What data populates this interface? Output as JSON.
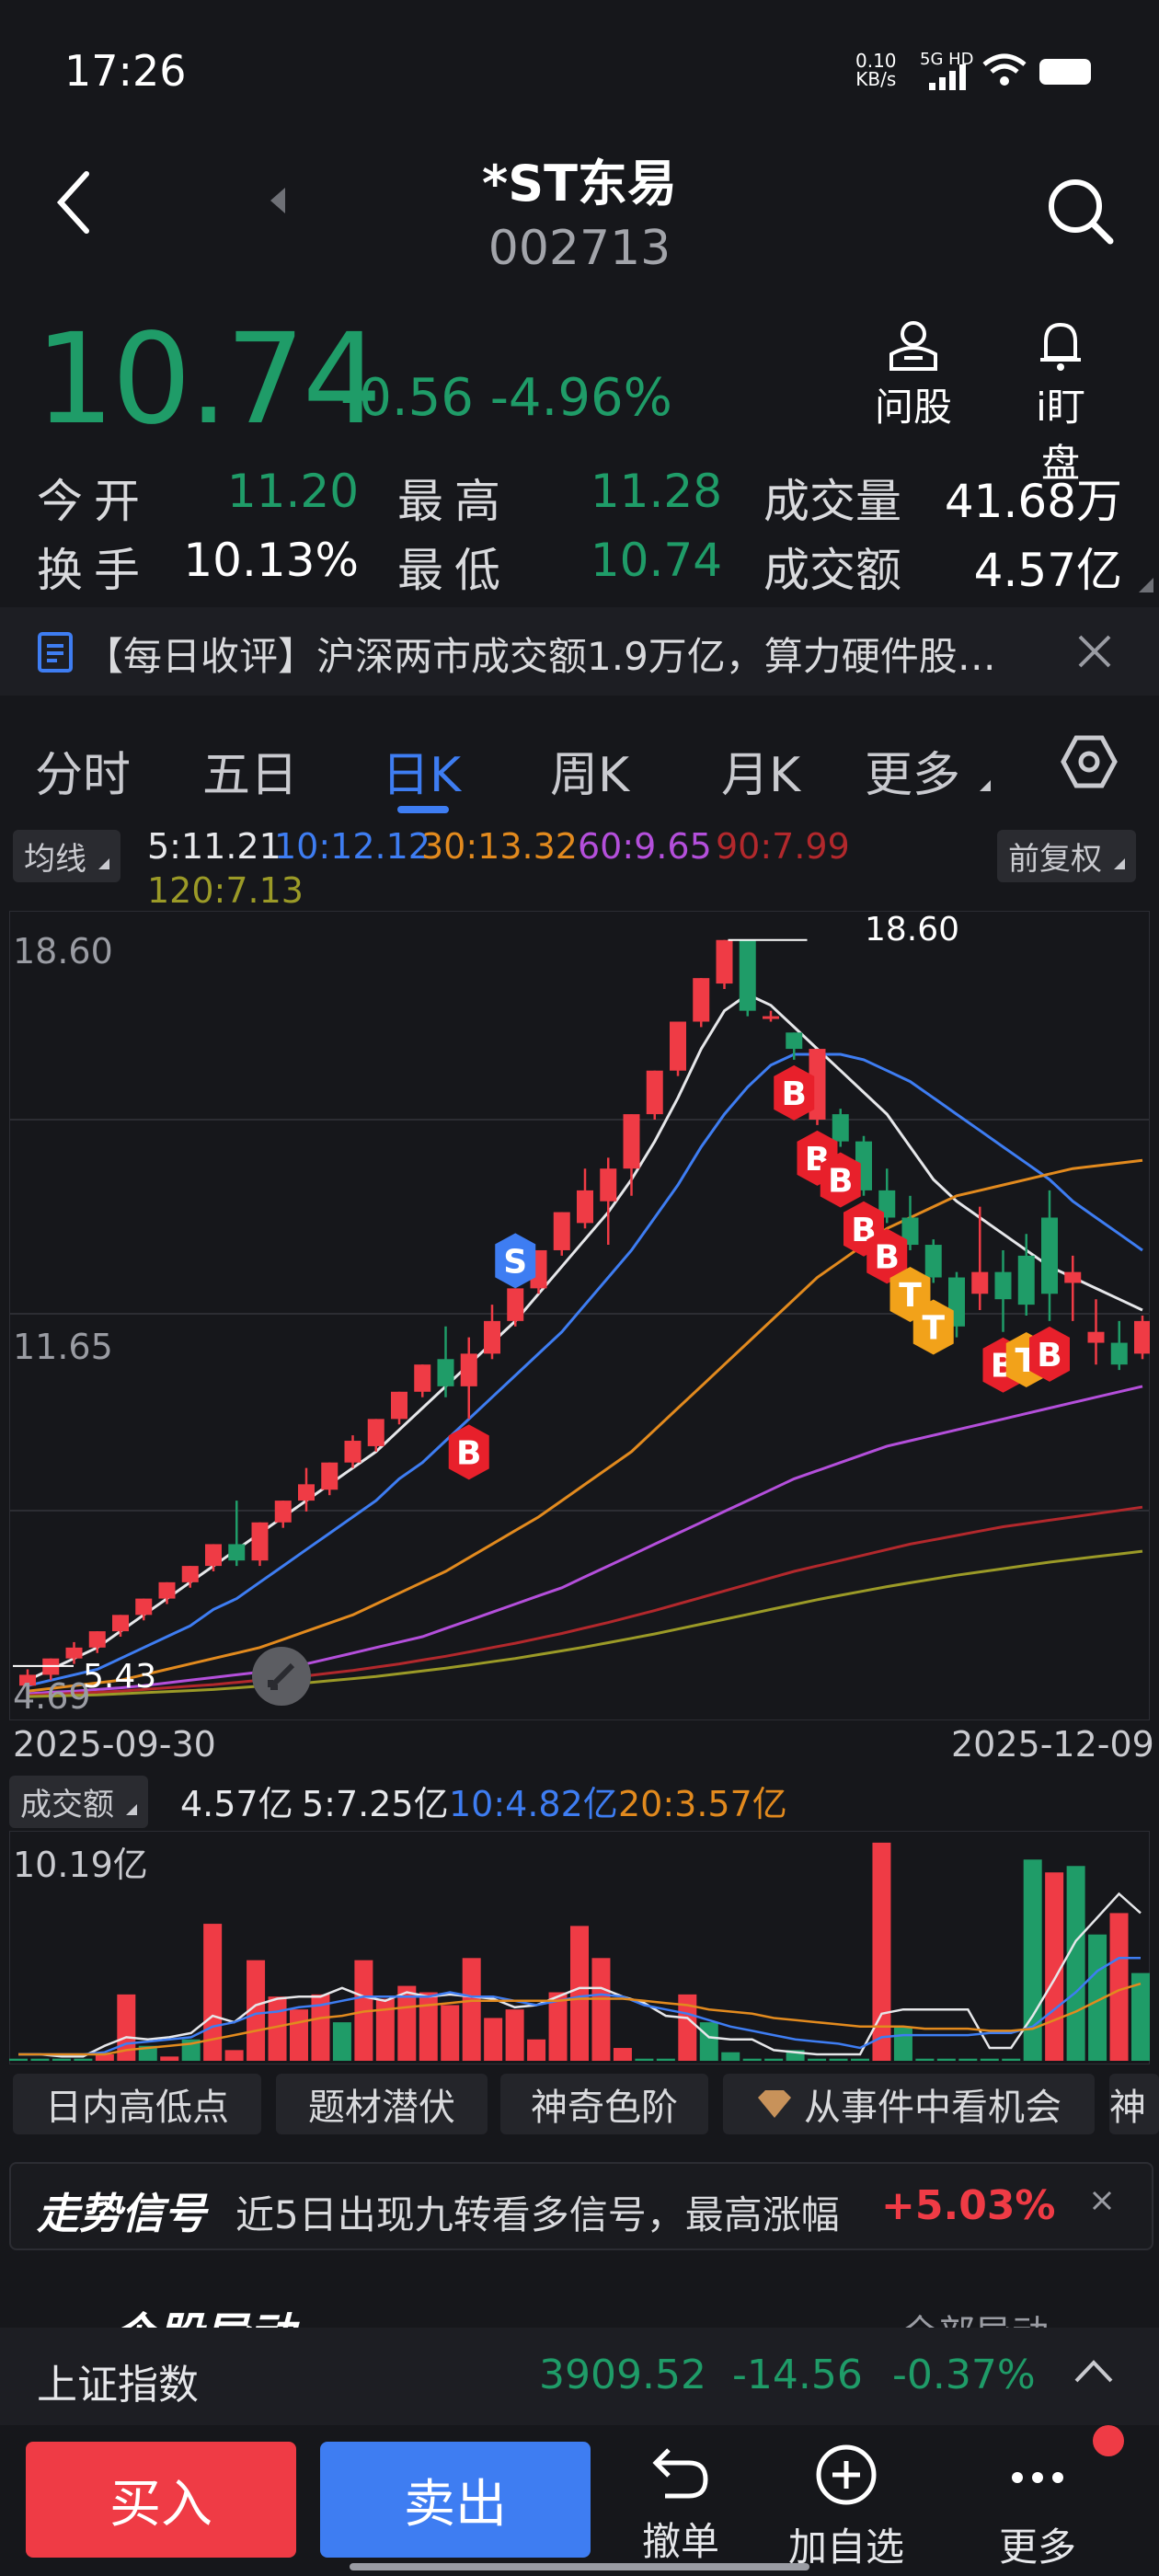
{
  "status": {
    "time": "17:26",
    "net_speed": "0.10",
    "net_unit": "KB/s",
    "network": "5G HD"
  },
  "header": {
    "name": "*ST东易",
    "code": "002713"
  },
  "quote": {
    "price": "10.74",
    "change": "-0.56",
    "change_pct": "-4.96%",
    "ask_label": "问股",
    "watch_label": "i盯盘",
    "open_label": "今开",
    "open": "11.20",
    "high_label": "最高",
    "high": "11.28",
    "volume_label": "成交量",
    "volume": "41.68万",
    "turnover_label": "换手",
    "turnover": "10.13%",
    "low_label": "最低",
    "low": "10.74",
    "amount_label": "成交额",
    "amount": "4.57亿"
  },
  "news": {
    "text": "【每日收评】沪深两市成交额1.9万亿，算力硬件股…"
  },
  "tabs": [
    {
      "label": "分时"
    },
    {
      "label": "五日"
    },
    {
      "label": "日K"
    },
    {
      "label": "周K"
    },
    {
      "label": "月K"
    },
    {
      "label": "更多"
    }
  ],
  "ma_legend": {
    "selector": "均线",
    "ma5": "5:11.21",
    "ma10": "10:12.12",
    "ma30": "30:13.32",
    "ma60": "60:9.65",
    "ma90": "90:7.99",
    "ma120": "120:7.13",
    "adjust": "前复权"
  },
  "chart_data": {
    "type": "candlestick",
    "price_labels": {
      "top": "18.60",
      "mid": "11.65",
      "bottom": "4.69",
      "max_marker": "18.60",
      "min_marker": "5.43"
    },
    "date_start": "2025-09-30",
    "date_end": "2025-12-09",
    "candles": [
      [
        4.9,
        5.1,
        4.8,
        5.2
      ],
      [
        5.1,
        5.4,
        5.0,
        5.4
      ],
      [
        5.4,
        5.6,
        5.3,
        5.7
      ],
      [
        5.6,
        5.9,
        5.5,
        5.9
      ],
      [
        5.9,
        6.2,
        5.8,
        6.2
      ],
      [
        6.2,
        6.5,
        6.1,
        6.5
      ],
      [
        6.5,
        6.8,
        6.4,
        6.8
      ],
      [
        6.8,
        7.1,
        6.7,
        7.1
      ],
      [
        7.1,
        7.5,
        7.0,
        7.5
      ],
      [
        7.5,
        7.2,
        7.1,
        8.3
      ],
      [
        7.2,
        7.9,
        7.1,
        7.9
      ],
      [
        7.9,
        8.3,
        7.8,
        8.3
      ],
      [
        8.3,
        8.6,
        8.1,
        8.9
      ],
      [
        8.5,
        9.0,
        8.4,
        9.0
      ],
      [
        9.0,
        9.4,
        8.9,
        9.5
      ],
      [
        9.3,
        9.8,
        9.2,
        9.8
      ],
      [
        9.8,
        10.3,
        9.7,
        10.3
      ],
      [
        10.3,
        10.8,
        10.2,
        10.8
      ],
      [
        10.9,
        10.4,
        10.2,
        11.5
      ],
      [
        10.4,
        11.0,
        9.8,
        11.3
      ],
      [
        11.0,
        11.6,
        10.9,
        11.9
      ],
      [
        11.6,
        12.2,
        11.5,
        12.2
      ],
      [
        12.2,
        12.9,
        12.1,
        12.9
      ],
      [
        12.9,
        13.6,
        12.8,
        13.6
      ],
      [
        13.4,
        14.0,
        13.3,
        14.4
      ],
      [
        13.8,
        14.4,
        13.0,
        14.6
      ],
      [
        14.4,
        15.4,
        13.9,
        15.4
      ],
      [
        15.4,
        16.2,
        15.3,
        16.2
      ],
      [
        16.2,
        17.1,
        16.1,
        17.1
      ],
      [
        17.1,
        17.9,
        17.0,
        17.9
      ],
      [
        17.8,
        18.6,
        17.7,
        18.6
      ],
      [
        18.6,
        17.3,
        17.2,
        18.6
      ],
      [
        17.2,
        17.2,
        17.1,
        17.3
      ],
      [
        16.9,
        16.6,
        16.4,
        16.9
      ],
      [
        15.3,
        16.6,
        15.2,
        16.6
      ],
      [
        15.4,
        14.9,
        14.8,
        15.5
      ],
      [
        14.9,
        14.0,
        13.9,
        15.0
      ],
      [
        14.0,
        13.5,
        13.4,
        14.4
      ],
      [
        13.5,
        13.0,
        12.9,
        13.9
      ],
      [
        13.0,
        12.4,
        12.3,
        13.1
      ],
      [
        12.4,
        11.5,
        11.3,
        12.5
      ],
      [
        12.1,
        12.5,
        11.8,
        13.7
      ],
      [
        12.5,
        12.0,
        11.4,
        12.9
      ],
      [
        12.8,
        11.9,
        11.7,
        13.2
      ],
      [
        13.5,
        12.1,
        11.6,
        14.0
      ],
      [
        12.3,
        12.5,
        11.6,
        12.8
      ],
      [
        11.2,
        11.4,
        10.8,
        12.0
      ],
      [
        11.2,
        10.8,
        10.7,
        11.6
      ],
      [
        11.0,
        11.6,
        10.9,
        11.7
      ]
    ],
    "signals": [
      {
        "type": "B",
        "index": 19
      },
      {
        "type": "S",
        "index": 21
      },
      {
        "type": "B",
        "index": 33
      },
      {
        "type": "B",
        "index": 34
      },
      {
        "type": "B",
        "index": 35
      },
      {
        "type": "B",
        "index": 36
      },
      {
        "type": "B",
        "index": 37
      },
      {
        "type": "T",
        "index": 38
      },
      {
        "type": "T",
        "index": 39
      },
      {
        "type": "B",
        "index": 42
      },
      {
        "type": "T",
        "index": 43
      },
      {
        "type": "B",
        "index": 44
      }
    ],
    "moving_averages": [
      {
        "name": "MA5",
        "color": "#e6e7ea",
        "values": [
          5.0,
          5.2,
          5.4,
          5.6,
          5.9,
          6.2,
          6.5,
          6.8,
          7.1,
          7.4,
          7.7,
          8.0,
          8.3,
          8.6,
          8.9,
          9.2,
          9.6,
          10.0,
          10.4,
          10.8,
          11.2,
          11.6,
          12.1,
          12.6,
          13.1,
          13.6,
          14.2,
          14.9,
          15.7,
          16.6,
          17.3,
          17.6,
          17.4,
          17.0,
          16.6,
          16.2,
          15.8,
          15.4,
          14.8,
          14.2,
          13.8,
          13.5,
          13.2,
          12.9,
          12.6,
          12.4,
          12.2,
          12.0,
          11.8
        ]
      },
      {
        "name": "MA10",
        "color": "#3e7df2",
        "values": [
          4.9,
          5.0,
          5.1,
          5.2,
          5.4,
          5.6,
          5.8,
          6.0,
          6.3,
          6.5,
          6.8,
          7.1,
          7.4,
          7.7,
          8.0,
          8.3,
          8.7,
          9.0,
          9.4,
          9.8,
          10.2,
          10.6,
          11.0,
          11.4,
          11.9,
          12.4,
          12.9,
          13.5,
          14.1,
          14.8,
          15.4,
          15.9,
          16.3,
          16.5,
          16.5,
          16.5,
          16.4,
          16.2,
          16.0,
          15.7,
          15.4,
          15.1,
          14.8,
          14.5,
          14.2,
          13.8,
          13.5,
          13.2,
          12.9
        ]
      },
      {
        "name": "MA30",
        "color": "#e28a1e",
        "values": [
          4.8,
          4.85,
          4.9,
          4.95,
          5.0,
          5.1,
          5.2,
          5.3,
          5.4,
          5.5,
          5.6,
          5.75,
          5.9,
          6.05,
          6.2,
          6.4,
          6.6,
          6.8,
          7.0,
          7.25,
          7.5,
          7.75,
          8.0,
          8.3,
          8.6,
          8.9,
          9.2,
          9.6,
          10.0,
          10.4,
          10.8,
          11.2,
          11.6,
          12.0,
          12.4,
          12.7,
          13.0,
          13.3,
          13.5,
          13.7,
          13.9,
          14.0,
          14.1,
          14.2,
          14.3,
          14.4,
          14.45,
          14.5,
          14.55
        ]
      },
      {
        "name": "MA60",
        "color": "#b44fdb",
        "values": [
          4.75,
          4.78,
          4.8,
          4.83,
          4.86,
          4.9,
          4.95,
          5.0,
          5.05,
          5.1,
          5.15,
          5.2,
          5.3,
          5.4,
          5.5,
          5.6,
          5.7,
          5.8,
          5.95,
          6.1,
          6.25,
          6.4,
          6.55,
          6.7,
          6.9,
          7.1,
          7.3,
          7.5,
          7.7,
          7.9,
          8.1,
          8.3,
          8.5,
          8.7,
          8.85,
          9.0,
          9.15,
          9.3,
          9.4,
          9.5,
          9.6,
          9.7,
          9.8,
          9.9,
          10.0,
          10.1,
          10.2,
          10.3,
          10.4
        ]
      },
      {
        "name": "MA90",
        "color": "#b2282c",
        "values": [
          4.72,
          4.74,
          4.76,
          4.78,
          4.8,
          4.83,
          4.86,
          4.89,
          4.92,
          4.96,
          5.0,
          5.04,
          5.08,
          5.13,
          5.18,
          5.24,
          5.3,
          5.37,
          5.44,
          5.52,
          5.6,
          5.68,
          5.77,
          5.86,
          5.96,
          6.06,
          6.17,
          6.28,
          6.4,
          6.52,
          6.64,
          6.76,
          6.88,
          7.0,
          7.1,
          7.2,
          7.3,
          7.4,
          7.5,
          7.58,
          7.66,
          7.74,
          7.82,
          7.88,
          7.94,
          8.0,
          8.06,
          8.12,
          8.18
        ]
      },
      {
        "name": "MA120",
        "color": "#9b9a27",
        "values": [
          4.7,
          4.71,
          4.72,
          4.73,
          4.75,
          4.77,
          4.79,
          4.81,
          4.83,
          4.86,
          4.89,
          4.92,
          4.95,
          4.99,
          5.03,
          5.07,
          5.12,
          5.17,
          5.22,
          5.28,
          5.34,
          5.4,
          5.47,
          5.54,
          5.61,
          5.69,
          5.77,
          5.85,
          5.94,
          6.03,
          6.12,
          6.21,
          6.3,
          6.39,
          6.48,
          6.56,
          6.64,
          6.72,
          6.79,
          6.86,
          6.93,
          6.99,
          7.05,
          7.11,
          7.17,
          7.22,
          7.27,
          7.32,
          7.37
        ]
      }
    ],
    "volume": {
      "selector": "成交额",
      "current": "4.57亿",
      "ma5": "5:7.25亿",
      "ma10": "10:4.82亿",
      "ma20": "20:3.57亿",
      "top_label": "10.19亿",
      "values": [
        0.1,
        0.1,
        0.1,
        0.1,
        0.3,
        3.1,
        0.7,
        0.2,
        1.0,
        6.4,
        0.5,
        4.7,
        3.0,
        2.4,
        3.1,
        1.8,
        4.7,
        2.9,
        3.5,
        3.2,
        2.6,
        4.8,
        2.0,
        2.4,
        1.0,
        3.2,
        6.3,
        4.8,
        0.6,
        0.1,
        0.1,
        3.1,
        1.8,
        0.4,
        0.1,
        0.1,
        0.5,
        0.1,
        0.1,
        0.1,
        10.19,
        1.6,
        0.1,
        0.1,
        0.1,
        0.1,
        0.1,
        9.4,
        8.8,
        9.1,
        5.9,
        6.9,
        4.1
      ],
      "colors": [
        "g",
        "g",
        "g",
        "g",
        "r",
        "r",
        "g",
        "r",
        "g",
        "r",
        "r",
        "r",
        "r",
        "r",
        "r",
        "g",
        "r",
        "r",
        "r",
        "r",
        "r",
        "r",
        "r",
        "r",
        "r",
        "r",
        "r",
        "r",
        "r",
        "g",
        "g",
        "r",
        "g",
        "g",
        "g",
        "g",
        "g",
        "g",
        "g",
        "g",
        "r",
        "g",
        "g",
        "g",
        "g",
        "g",
        "g",
        "g",
        "r",
        "g",
        "g",
        "r",
        "g"
      ],
      "line5": [
        0.3,
        0.3,
        0.2,
        0.2,
        0.7,
        1.1,
        1.0,
        1.1,
        1.3,
        2.1,
        1.8,
        2.6,
        2.9,
        3.0,
        3.0,
        3.4,
        3.0,
        2.8,
        3.2,
        3.0,
        3.1,
        3.0,
        2.9,
        2.5,
        2.6,
        3.0,
        3.4,
        3.4,
        3.0,
        2.7,
        2.1,
        2.0,
        1.1,
        1.0,
        1.0,
        0.5,
        0.4,
        0.3,
        0.3,
        0.3,
        2.2,
        2.4,
        2.4,
        2.4,
        2.4,
        0.6,
        0.6,
        2.1,
        3.8,
        5.6,
        6.7,
        7.8,
        6.9
      ],
      "line10": [
        0.3,
        0.3,
        0.3,
        0.3,
        0.4,
        0.8,
        0.9,
        1.0,
        1.1,
        1.6,
        1.8,
        2.2,
        2.3,
        2.5,
        2.6,
        2.8,
        3.0,
        3.0,
        3.0,
        3.0,
        3.2,
        3.0,
        3.0,
        2.8,
        2.6,
        2.8,
        3.0,
        3.1,
        3.0,
        2.6,
        2.4,
        2.2,
        1.9,
        1.6,
        1.4,
        1.2,
        1.0,
        0.9,
        0.8,
        0.6,
        1.1,
        1.2,
        1.2,
        1.2,
        1.2,
        1.3,
        1.3,
        1.6,
        2.4,
        3.2,
        4.2,
        4.8,
        4.8
      ],
      "line20": [
        0.3,
        0.3,
        0.3,
        0.3,
        0.3,
        0.5,
        0.6,
        0.7,
        0.8,
        1.0,
        1.2,
        1.4,
        1.6,
        1.8,
        2.0,
        2.1,
        2.3,
        2.4,
        2.5,
        2.6,
        2.7,
        2.8,
        2.8,
        2.8,
        2.8,
        2.8,
        2.9,
        2.9,
        2.9,
        2.8,
        2.7,
        2.6,
        2.4,
        2.3,
        2.2,
        2.0,
        1.9,
        1.8,
        1.7,
        1.6,
        1.6,
        1.6,
        1.5,
        1.5,
        1.5,
        1.4,
        1.4,
        1.5,
        1.9,
        2.3,
        2.8,
        3.3,
        3.6
      ]
    }
  },
  "tools": [
    {
      "label": "日内高低点"
    },
    {
      "label": "题材潜伏"
    },
    {
      "label": "神奇色阶"
    },
    {
      "label": "从事件中看机会"
    },
    {
      "label": "神"
    }
  ],
  "signal": {
    "title": "走势信号",
    "text": "近5日出现九转看多信号，最高涨幅",
    "value": "+5.03%"
  },
  "hidden_section": {
    "title": "个股异动",
    "more": "全部异动"
  },
  "index": {
    "name": "上证指数",
    "value": "3909.52",
    "change": "-14.56",
    "pct": "-0.37%"
  },
  "bottom": {
    "buy": "买入",
    "sell": "卖出",
    "cancel": "撤单",
    "add": "加自选",
    "more": "更多"
  }
}
